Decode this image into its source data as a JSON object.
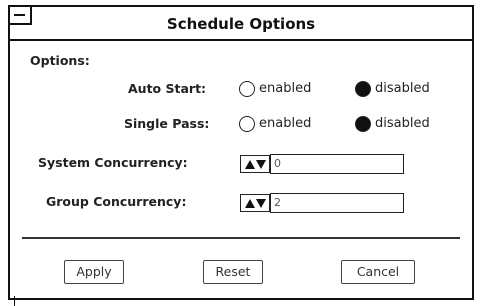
{
  "window": {
    "title": "Schedule Options"
  },
  "options_heading": "Options:",
  "auto_start": {
    "label": "Auto Start:",
    "enabled_label": "enabled",
    "disabled_label": "disabled",
    "selected": "disabled"
  },
  "single_pass": {
    "label": "Single Pass:",
    "enabled_label": "enabled",
    "disabled_label": "disabled",
    "selected": "disabled"
  },
  "system_concurrency": {
    "label": "System Concurrency:",
    "value": "0"
  },
  "group_concurrency": {
    "label": "Group Concurrency:",
    "value": "2"
  },
  "buttons": {
    "apply": "Apply",
    "reset": "Reset",
    "cancel": "Cancel"
  }
}
